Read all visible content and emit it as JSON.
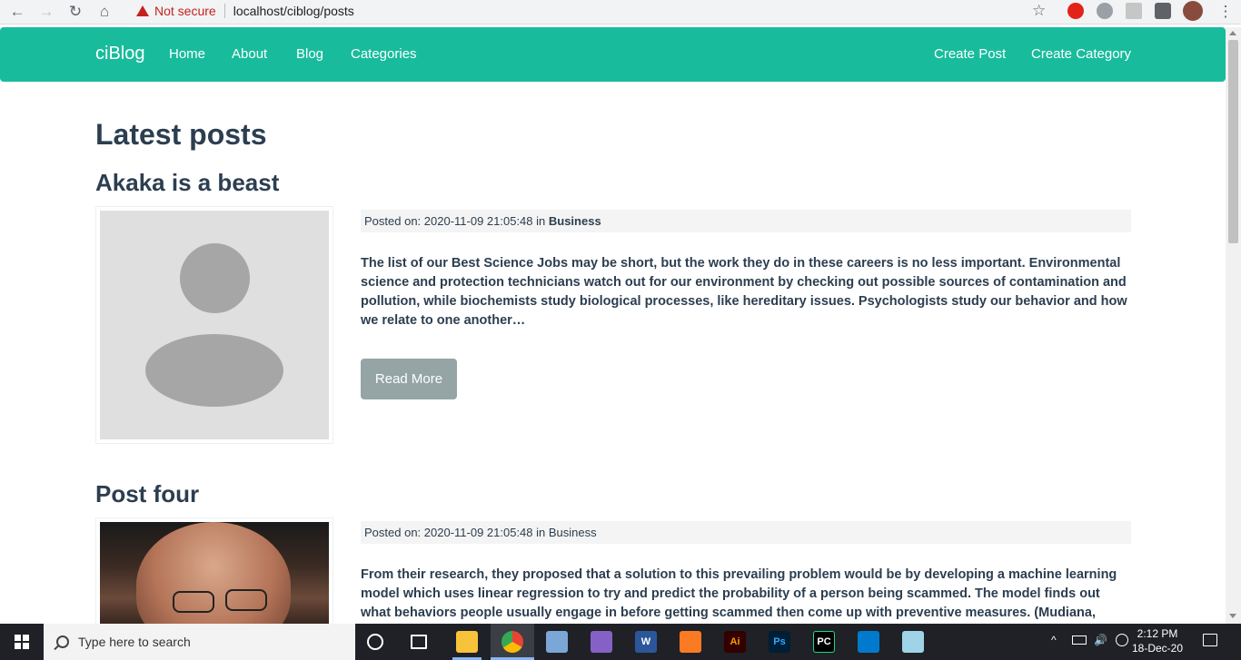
{
  "browser": {
    "security_label": "Not secure",
    "url": "localhost/ciblog/posts"
  },
  "navbar": {
    "brand": "ciBlog",
    "links": [
      "Home",
      "About",
      "Blog",
      "Categories"
    ],
    "right_links": [
      "Create Post",
      "Create Category"
    ],
    "color": "#18bc9c"
  },
  "main": {
    "heading": "Latest posts",
    "posts": [
      {
        "title": "Akaka is a beast",
        "image": "placeholder-avatar",
        "meta_prefix": "Posted on: 2020-11-09 21:05:48 in",
        "category": "Business",
        "excerpt": "The list of our Best Science Jobs may be short, but the work they do in these careers is no less important. Environmental science and protection technicians watch out for our environment by checking out possible sources of contamination and pollution, while biochemists study biological processes, like hereditary issues. Psychologists study our behavior and how we relate to one another…",
        "read_more": "Read More"
      },
      {
        "title": "Post four",
        "image": "portrait-photo",
        "meta_prefix": "Posted on: 2020-11-09 21:05:48 in",
        "category": "Business",
        "excerpt": "From their research, they proposed that a solution to this prevailing problem would be by developing a machine learning model which uses linear regression to try and predict the probability of a person being scammed. The model finds out what behaviors people usually engage in before getting scammed then come up with preventive measures. (Mudiana, Azhar, Amer, Norshima"
      }
    ]
  },
  "taskbar": {
    "search_placeholder": "Type here to search",
    "time": "2:12 PM",
    "date": "18-Dec-20",
    "apps": [
      "cortana-icon",
      "task-view-icon",
      "file-explorer-icon",
      "chrome-icon",
      "box-app-icon",
      "visual-studio-icon",
      "word-icon",
      "xampp-icon",
      "illustrator-icon",
      "photoshop-icon",
      "pycharm-icon",
      "vscode-icon",
      "notepad-icon"
    ]
  }
}
